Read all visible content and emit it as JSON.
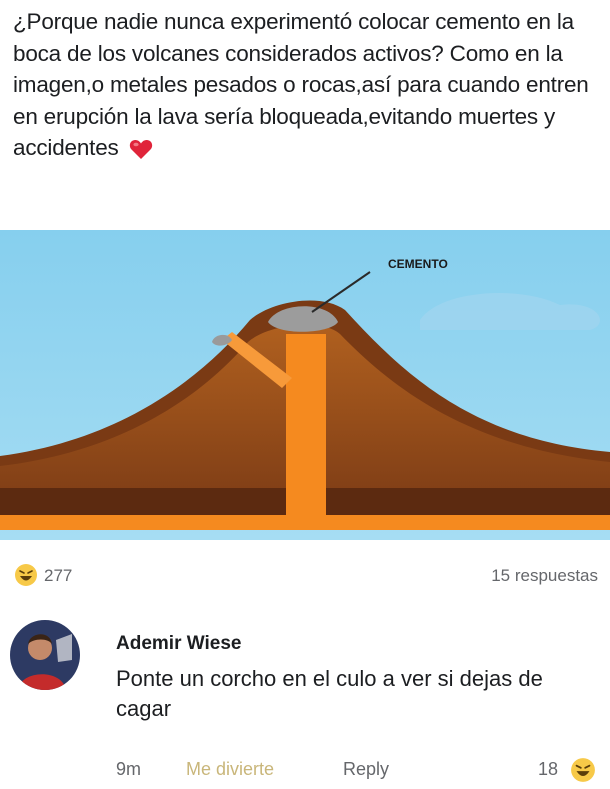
{
  "post": {
    "text": "¿Porque nadie nunca experimentó colocar cemento en la boca de los volcanes considerados activos? Como en la imagen,o metales pesados o rocas,así para cuando entren en erupción la lava sería bloqueada,evitando muertes y accidentes",
    "heart_icon": "red-heart-icon"
  },
  "illustration": {
    "label": "CEMENTO",
    "colors": {
      "sky": "#8ed3ef",
      "mountain": "#9a4f1d",
      "lava": "#f58a1f",
      "cement": "#9a9a9a"
    }
  },
  "reactions": {
    "emoji": "haha-emoji",
    "count": "277",
    "replies": "15 respuestas"
  },
  "comment": {
    "author": "Ademir Wiese",
    "text": "Ponte un corcho en el culo a ver si dejas de cagar",
    "time": "9m",
    "like_label": "Me divierte",
    "reply_label": "Reply",
    "reaction_count": "18",
    "reaction_emoji": "haha-emoji"
  }
}
